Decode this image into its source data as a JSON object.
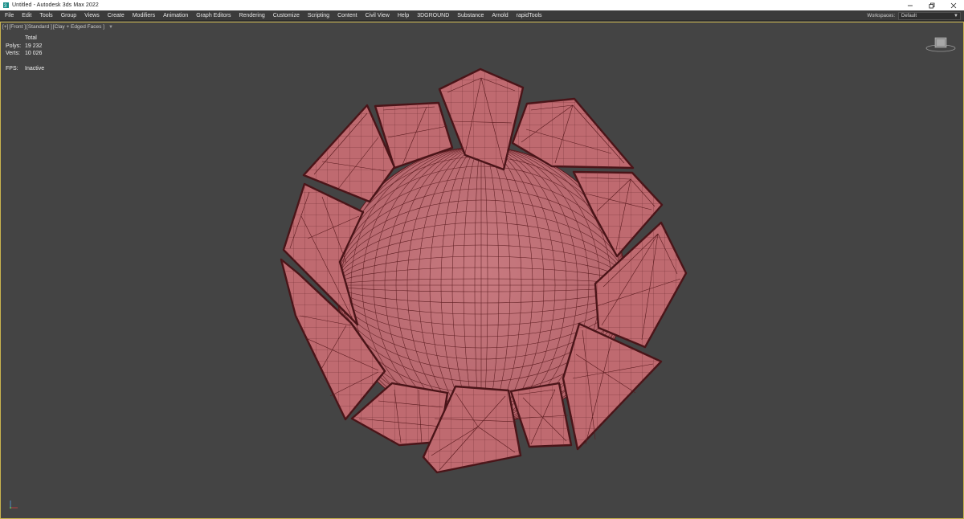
{
  "window": {
    "title": "Untitled - Autodesk 3ds Max 2022",
    "app_icon": "3dsmax-logo-icon",
    "controls": [
      "minimize-icon",
      "restore-icon",
      "close-icon"
    ]
  },
  "menubar": {
    "items": [
      "File",
      "Edit",
      "Tools",
      "Group",
      "Views",
      "Create",
      "Modifiers",
      "Animation",
      "Graph Editors",
      "Rendering",
      "Customize",
      "Scripting",
      "Content",
      "Civil View",
      "Help",
      "3DGROUND",
      "Substance",
      "Arnold",
      "rapidTools"
    ],
    "workspaces_label": "Workspaces:",
    "workspaces_value": "Default"
  },
  "viewport": {
    "label_parts": [
      "[+]",
      "[Front ]",
      "[Standard ]",
      "[Clay + Edged Faces ]"
    ],
    "stats": {
      "header": "Total",
      "polys_label": "Polys:",
      "polys_value": "19 232",
      "verts_label": "Verts:",
      "verts_value": "10 026",
      "fps_label": "FPS:",
      "fps_value": "Inactive"
    },
    "viewcube_icon": "viewcube-icon",
    "axis_icon": "axis-tripod-icon"
  },
  "colors": {
    "viewport_bg": "#444444",
    "clay": "#bf6a70",
    "edges": "#5a1a1e",
    "active_border": "#c8b34e",
    "menubar_bg": "#3b3b3b"
  }
}
